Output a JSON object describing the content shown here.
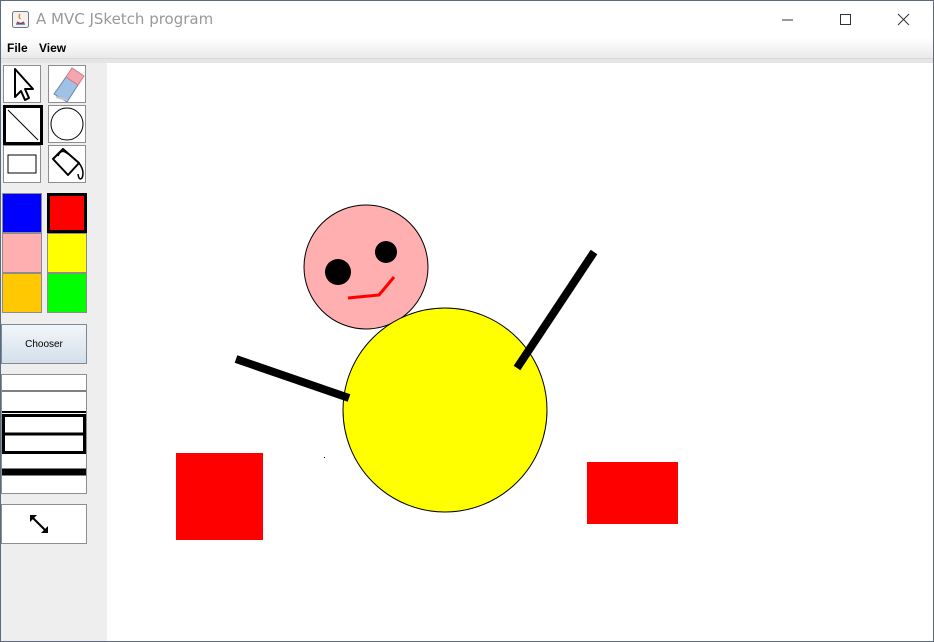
{
  "window": {
    "title": "A MVC JSketch program",
    "controls": [
      "minimize-icon",
      "maximize-icon",
      "close-icon"
    ]
  },
  "menubar": {
    "items": [
      {
        "label": "File"
      },
      {
        "label": "View"
      }
    ]
  },
  "tools": {
    "items": [
      {
        "name": "select",
        "icon": "cursor-arrow-icon",
        "selected": false
      },
      {
        "name": "erase",
        "icon": "eraser-icon",
        "selected": false
      },
      {
        "name": "line",
        "icon": "line-icon",
        "selected": true
      },
      {
        "name": "circle",
        "icon": "circle-icon",
        "selected": false
      },
      {
        "name": "rectangle",
        "icon": "rectangle-icon",
        "selected": false
      },
      {
        "name": "fill",
        "icon": "paint-bucket-icon",
        "selected": false
      }
    ]
  },
  "palette": {
    "colors": [
      {
        "name": "blue",
        "hex": "#0000ff",
        "selected": false
      },
      {
        "name": "red",
        "hex": "#ff0000",
        "selected": true
      },
      {
        "name": "pink",
        "hex": "#ffafaf",
        "selected": false
      },
      {
        "name": "yellow",
        "hex": "#ffff00",
        "selected": false
      },
      {
        "name": "orange",
        "hex": "#ffc800",
        "selected": false
      },
      {
        "name": "green",
        "hex": "#00ff00",
        "selected": false
      }
    ],
    "chooser_label": "Chooser"
  },
  "thickness": {
    "options": [
      {
        "level": 1,
        "selected": false
      },
      {
        "level": 2,
        "selected": false
      },
      {
        "level": 3,
        "selected": true
      },
      {
        "level": 4,
        "selected": false
      }
    ]
  },
  "resize_button": {
    "icon": "resize-diagonal-icon"
  },
  "canvas": {
    "shapes": [
      {
        "kind": "circle",
        "name": "head",
        "fill": "#ffafaf",
        "stroke": "#000000"
      },
      {
        "kind": "circle",
        "name": "left-eye",
        "fill": "#000000"
      },
      {
        "kind": "circle",
        "name": "right-eye",
        "fill": "#000000"
      },
      {
        "kind": "line",
        "name": "mouth",
        "stroke": "#ff0000"
      },
      {
        "kind": "circle",
        "name": "body",
        "fill": "#ffff00",
        "stroke": "#000000"
      },
      {
        "kind": "line",
        "name": "left-arm",
        "stroke": "#000000"
      },
      {
        "kind": "line",
        "name": "right-arm",
        "stroke": "#000000"
      },
      {
        "kind": "rectangle",
        "name": "left-block",
        "fill": "#ff0000"
      },
      {
        "kind": "rectangle",
        "name": "right-block",
        "fill": "#ff0000"
      }
    ]
  }
}
